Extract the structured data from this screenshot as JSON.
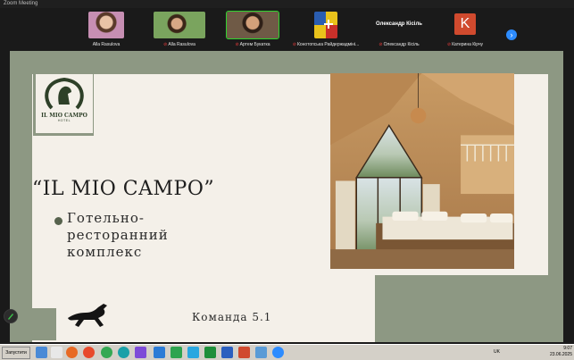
{
  "window": {
    "title": "Zoom Meeting"
  },
  "participants": [
    {
      "name": "Alla Rasulova",
      "muted": false,
      "type": "video"
    },
    {
      "name": "Alla Rasulova",
      "muted": true,
      "type": "video"
    },
    {
      "name": "Артем Букатка",
      "muted": true,
      "type": "video",
      "speaking": true
    },
    {
      "name": "Конотопська Райдержадміні...",
      "muted": true,
      "type": "image"
    },
    {
      "name": "Олександр Кісіль",
      "muted": true,
      "type": "name",
      "display": "Олександр Кісіль"
    },
    {
      "name": "Катерина Кірчу",
      "muted": true,
      "type": "avatar",
      "initial": "K"
    }
  ],
  "slide": {
    "logo_brand": "IL MIO CAMPO",
    "logo_sub": "HOTEL",
    "title": "“IL MIO CAMPO”",
    "subtitle": "Готельно-ресторанний комплекс",
    "team": "Команда 5.1"
  },
  "taskbar": {
    "start_label": "Запустити",
    "lang": "UK",
    "time": "9:07",
    "date": "23.06.2025"
  },
  "colors": {
    "sage": "#8d9883",
    "cream": "#f4f0e9",
    "zoom_blue": "#2d8cff"
  }
}
